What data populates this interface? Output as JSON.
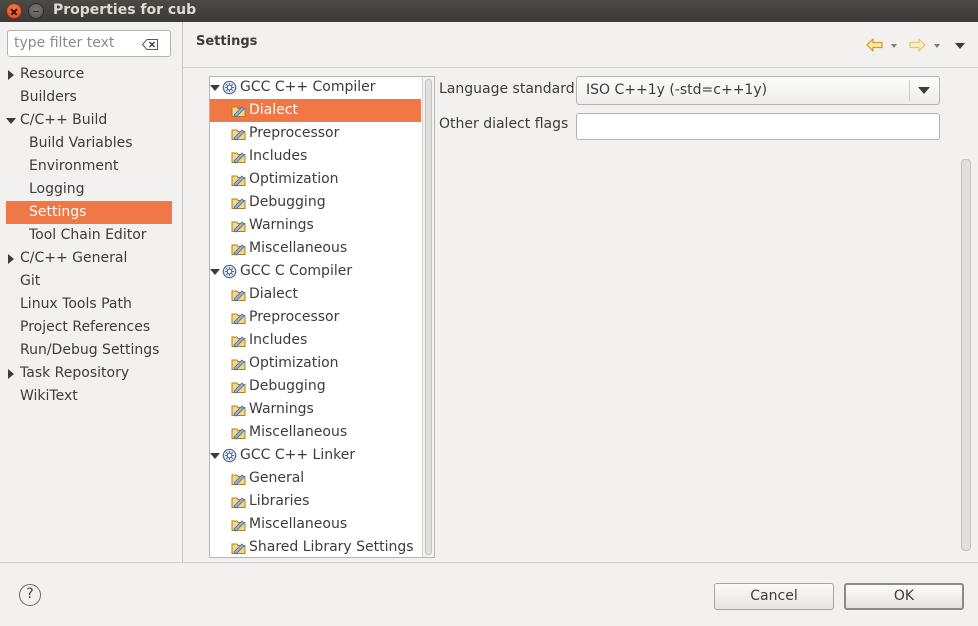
{
  "window": {
    "title": "Properties for cub"
  },
  "filter": {
    "placeholder": "type filter text"
  },
  "nav": {
    "items": [
      {
        "label": "Resource",
        "arrow": "right"
      },
      {
        "label": "Builders"
      },
      {
        "label": "C/C++ Build",
        "arrow": "down"
      },
      {
        "label": "Build Variables"
      },
      {
        "label": "Environment"
      },
      {
        "label": "Logging"
      },
      {
        "label": "Settings",
        "selected": true
      },
      {
        "label": "Tool Chain Editor"
      },
      {
        "label": "C/C++ General",
        "arrow": "right"
      },
      {
        "label": "Git"
      },
      {
        "label": "Linux Tools Path"
      },
      {
        "label": "Project References"
      },
      {
        "label": "Run/Debug Settings"
      },
      {
        "label": "Task Repository",
        "arrow": "right"
      },
      {
        "label": "WikiText"
      }
    ]
  },
  "header": {
    "title": "Settings"
  },
  "tool_tree": {
    "items": [
      {
        "label": "GCC C++ Compiler",
        "type": "tool"
      },
      {
        "label": "Dialect",
        "type": "option",
        "selected": true
      },
      {
        "label": "Preprocessor",
        "type": "option"
      },
      {
        "label": "Includes",
        "type": "option"
      },
      {
        "label": "Optimization",
        "type": "option"
      },
      {
        "label": "Debugging",
        "type": "option"
      },
      {
        "label": "Warnings",
        "type": "option"
      },
      {
        "label": "Miscellaneous",
        "type": "option"
      },
      {
        "label": "GCC C Compiler",
        "type": "tool"
      },
      {
        "label": "Dialect",
        "type": "option"
      },
      {
        "label": "Preprocessor",
        "type": "option"
      },
      {
        "label": "Includes",
        "type": "option"
      },
      {
        "label": "Optimization",
        "type": "option"
      },
      {
        "label": "Debugging",
        "type": "option"
      },
      {
        "label": "Warnings",
        "type": "option"
      },
      {
        "label": "Miscellaneous",
        "type": "option"
      },
      {
        "label": "GCC C++ Linker",
        "type": "tool"
      },
      {
        "label": "General",
        "type": "option"
      },
      {
        "label": "Libraries",
        "type": "option"
      },
      {
        "label": "Miscellaneous",
        "type": "option"
      },
      {
        "label": "Shared Library Settings",
        "type": "option"
      }
    ]
  },
  "form": {
    "language_standard_label": "Language standard",
    "language_standard_value": "ISO C++1y (-std=c++1y)",
    "other_flags_label": "Other dialect flags",
    "other_flags_value": ""
  },
  "footer": {
    "help_glyph": "?",
    "cancel_label": "Cancel",
    "ok_label": "OK"
  },
  "colors": {
    "selection": "#f07746",
    "titlebar": "#3c3b37",
    "background": "#f2f1f0",
    "nav_arrow": "#e8a33a"
  }
}
